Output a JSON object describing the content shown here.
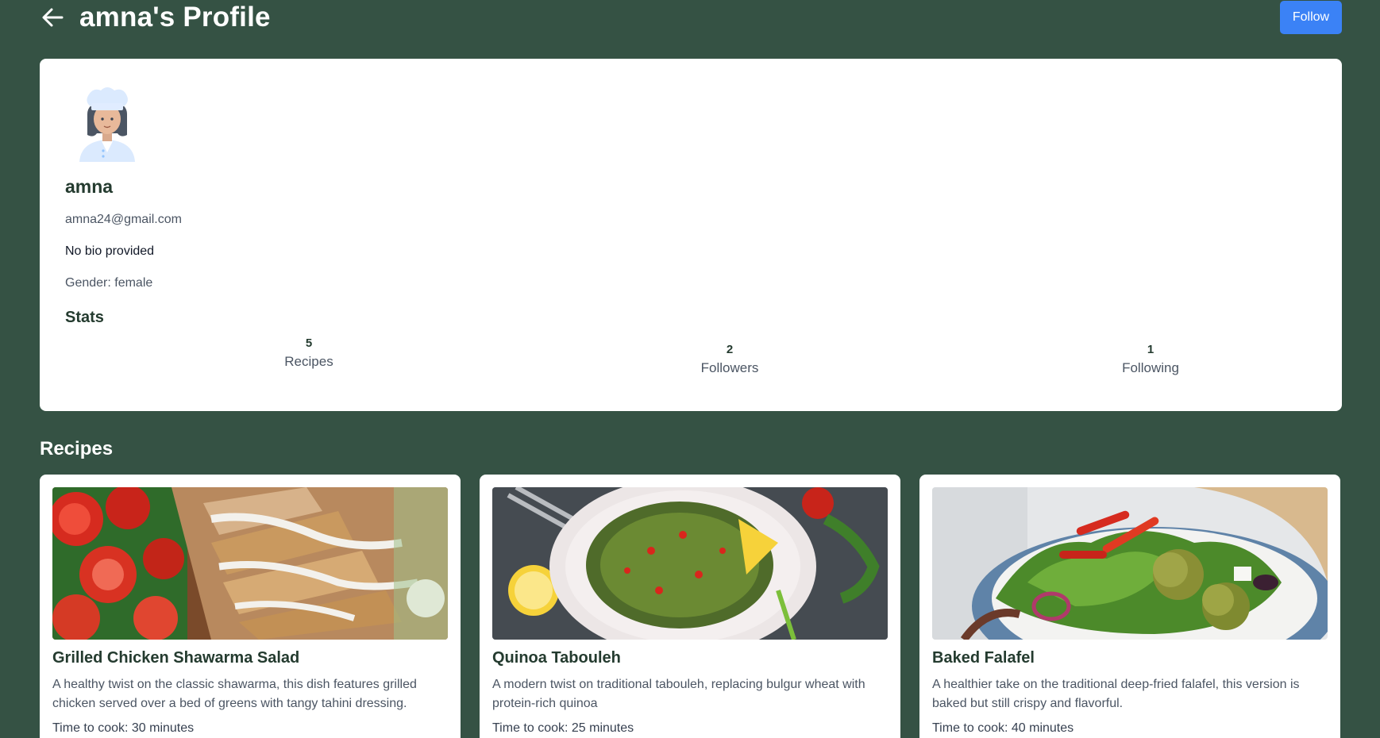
{
  "header": {
    "title": "amna's Profile",
    "follow_label": "Follow"
  },
  "profile": {
    "name": "amna",
    "email": "amna24@gmail.com",
    "bio": "No bio provided",
    "gender": "Gender: female",
    "stats_title": "Stats",
    "stats": [
      {
        "value": "5",
        "label": "Recipes"
      },
      {
        "value": "2",
        "label": "Followers"
      },
      {
        "value": "1",
        "label": "Following"
      }
    ]
  },
  "recipes": {
    "title": "Recipes",
    "items": [
      {
        "title": "Grilled Chicken Shawarma Salad",
        "description": "A healthy twist on the classic shawarma, this dish features grilled chicken served over a bed of greens with tangy tahini dressing.",
        "time": "Time to cook: 30 minutes"
      },
      {
        "title": "Quinoa Tabouleh",
        "description": "A modern twist on traditional tabouleh, replacing bulgur wheat with protein-rich quinoa",
        "time": "Time to cook: 25 minutes"
      },
      {
        "title": "Baked Falafel",
        "description": "A healthier take on the traditional deep-fried falafel, this version is baked but still crispy and flavorful.",
        "time": "Time to cook: 40 minutes"
      }
    ]
  },
  "colors": {
    "background": "#355244",
    "accent": "#3b82f6",
    "heading": "#243b2f"
  }
}
